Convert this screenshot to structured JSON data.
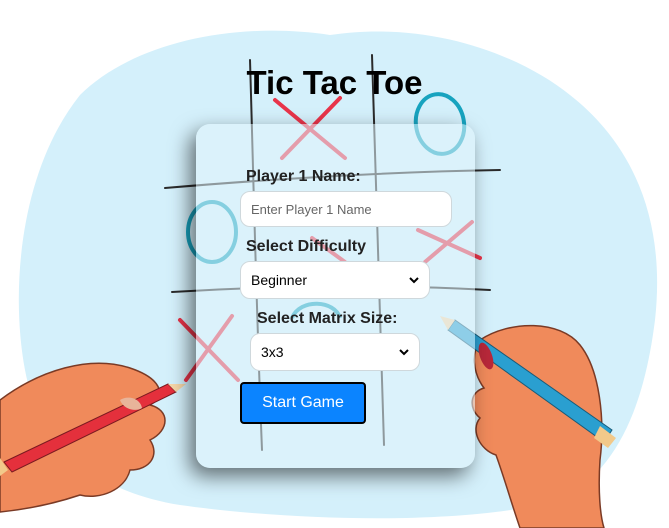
{
  "title": "Tic Tac Toe",
  "form": {
    "player1_label": "Player 1 Name:",
    "player1_placeholder": "Enter Player 1 Name",
    "difficulty_label": "Select Difficulty",
    "difficulty_value": "Beginner",
    "matrix_label": "Select Matrix Size:",
    "matrix_value": "3x3",
    "start_label": "Start Game"
  },
  "colors": {
    "background_blob": "#d4f0fb",
    "button": "#0b84ff",
    "x_marks": "#e8344a",
    "o_marks": "#17a3bf",
    "grid_lines": "#2b2b2b",
    "skin": "#f08a5b",
    "red_pencil": "#e4303c",
    "blue_pencil": "#2a9fd0"
  },
  "background_icons": [
    "hand-drawn-grid",
    "x-mark",
    "o-mark",
    "left-hand-with-red-pencil",
    "right-hand-with-blue-pencil"
  ]
}
